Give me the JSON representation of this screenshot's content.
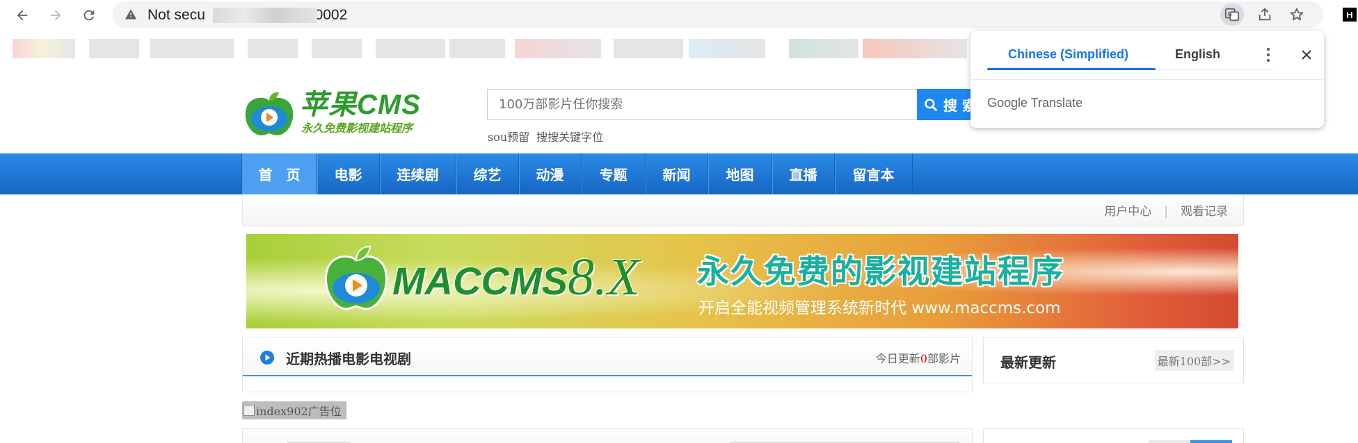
{
  "browser": {
    "url_visible_prefix": "Not secu",
    "url_visible_suffix": "60002",
    "profile_letter": "H"
  },
  "translate_popup": {
    "tab_active": "Chinese (Simplified)",
    "tab_inactive": "English",
    "brand": "Google Translate",
    "accent_color": "#1a73e8"
  },
  "site": {
    "logo_title": "苹果CMS",
    "logo_subtitle": "永久免费影视建站程序",
    "search_placeholder": "100万部影片任你搜索",
    "search_button": "搜 索",
    "hot_words": [
      "sou预留",
      "搜搜关键字位"
    ],
    "nav": [
      "首　页",
      "电影",
      "连续剧",
      "综艺",
      "动漫",
      "专题",
      "新闻",
      "地图",
      "直播",
      "留言本"
    ],
    "nav_active_index": 0,
    "user_links": [
      "用户中心",
      "观看记录"
    ],
    "banner": {
      "brand": "MACCMS",
      "version": "8.X",
      "slogan": "永久免费的影视建站程序",
      "tagline": "开启全能视频管理系统新时代 www.maccms.com"
    },
    "hot_panel": {
      "title": "近期热播电影电视剧",
      "today_prefix": "今日更新",
      "today_count": "0",
      "today_suffix": "部影片"
    },
    "new_panel": {
      "title": "最新更新",
      "more": "最新100部>>"
    },
    "ad_alt": "index902广告位",
    "brand_blue": "#1e87f0"
  }
}
